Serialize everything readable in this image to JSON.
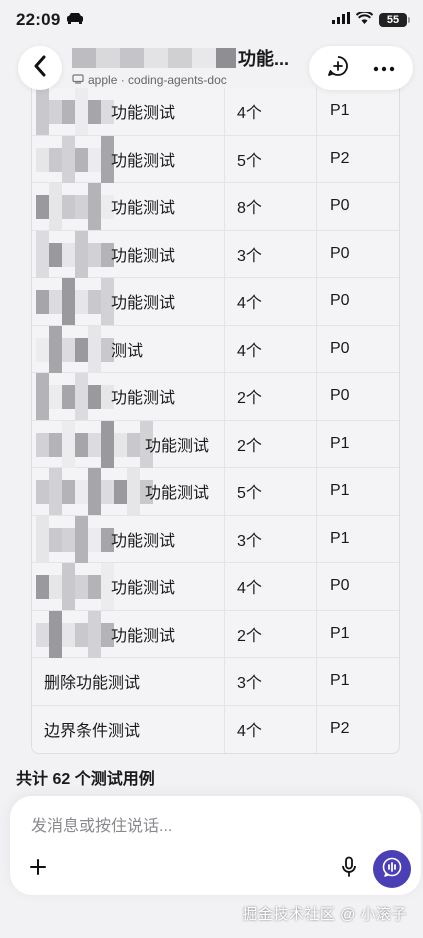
{
  "status_bar": {
    "time": "22:09",
    "battery": "55"
  },
  "header": {
    "title": "功能...",
    "subtitle": "apple · coding-agents-doc"
  },
  "table": {
    "rows": [
      {
        "name": "功能测试",
        "count": "4个",
        "priority": "P1",
        "blurred_prefix": true
      },
      {
        "name": "功能测试",
        "count": "5个",
        "priority": "P2",
        "blurred_prefix": true
      },
      {
        "name": "功能测试",
        "count": "8个",
        "priority": "P0",
        "blurred_prefix": true
      },
      {
        "name": "功能测试",
        "count": "3个",
        "priority": "P0",
        "blurred_prefix": true
      },
      {
        "name": "功能测试",
        "count": "4个",
        "priority": "P0",
        "blurred_prefix": true
      },
      {
        "name": "测试",
        "count": "4个",
        "priority": "P0",
        "blurred_prefix": true
      },
      {
        "name": "功能测试",
        "count": "2个",
        "priority": "P0",
        "blurred_prefix": true
      },
      {
        "name": "功能测试",
        "count": "2个",
        "priority": "P1",
        "blurred_prefix": true
      },
      {
        "name": "功能测试",
        "count": "5个",
        "priority": "P1",
        "blurred_prefix": true
      },
      {
        "name": "功能测试",
        "count": "3个",
        "priority": "P1",
        "blurred_prefix": true
      },
      {
        "name": "功能测试",
        "count": "4个",
        "priority": "P0",
        "blurred_prefix": true
      },
      {
        "name": "功能测试",
        "count": "2个",
        "priority": "P1",
        "blurred_prefix": true
      },
      {
        "name": "删除功能测试",
        "count": "3个",
        "priority": "P1",
        "blurred_prefix": false
      },
      {
        "name": "边界条件测试",
        "count": "4个",
        "priority": "P2",
        "blurred_prefix": false
      }
    ]
  },
  "summary": {
    "total": "共计 62 个测试用例"
  },
  "composer": {
    "placeholder": "发消息或按住说话..."
  },
  "watermark": "掘金技术社区 @ 小滚子",
  "colors": {
    "accent": "#4a3fb4",
    "background": "#f2f2f5"
  }
}
